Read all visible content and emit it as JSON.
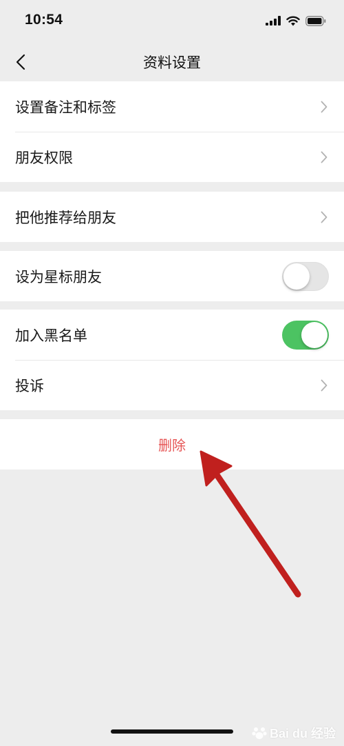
{
  "status_bar": {
    "time": "10:54",
    "icons": [
      "signal-icon",
      "wifi-icon",
      "battery-icon"
    ]
  },
  "nav": {
    "title": "资料设置",
    "back_icon": "chevron-left-icon"
  },
  "groups": {
    "group1": [
      {
        "label": "设置备注和标签",
        "accessory": "chevron-right-icon"
      },
      {
        "label": "朋友权限",
        "accessory": "chevron-right-icon"
      }
    ],
    "group2": [
      {
        "label": "把他推荐给朋友",
        "accessory": "chevron-right-icon"
      }
    ],
    "group3": [
      {
        "label": "设为星标朋友",
        "accessory": "toggle",
        "toggle_on": false
      }
    ],
    "group4": [
      {
        "label": "加入黑名单",
        "accessory": "toggle",
        "toggle_on": true
      },
      {
        "label": "投诉",
        "accessory": "chevron-right-icon"
      }
    ]
  },
  "delete": {
    "label": "删除",
    "color": "#e65454"
  },
  "colors": {
    "background": "#ededed",
    "toggle_on": "#4cc362",
    "annotation_arrow": "#c0201e"
  },
  "watermark": {
    "text": "Bai du 经验"
  }
}
